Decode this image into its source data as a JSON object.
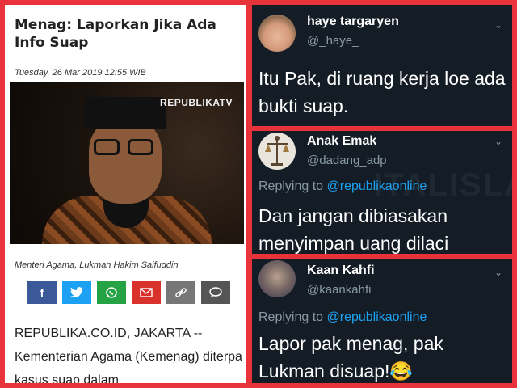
{
  "article": {
    "headline": "Menag: Laporkan Jika Ada Info Suap",
    "date": "Tuesday, 26 Mar 2019 12:55 WIB",
    "photo_brand": "REPUBLIKATV",
    "caption": "Menteri Agama, Lukman Hakim Saifuddin",
    "share_icons": [
      "facebook-icon",
      "twitter-icon",
      "whatsapp-icon",
      "mail-icon",
      "link-icon",
      "comment-icon"
    ],
    "body": "REPUBLIKA.CO.ID, JAKARTA -- Kementerian Agama (Kemenag) diterpa kasus suap dalam"
  },
  "tweets": [
    {
      "name": "haye targaryen",
      "handle": "@_haye_",
      "text": "Itu Pak, di ruang kerja loe ada bukti suap."
    },
    {
      "name": "Anak Emak",
      "handle": "@dadang_adp",
      "replying_label": "Replying to ",
      "mention": "@republikaonline",
      "text": "Dan jangan dibiasakan menyimpan uang dilaci"
    },
    {
      "name": "Kaan Kahfi",
      "handle": "@kaankahfi",
      "replying_label": "Replying to ",
      "mention": "@republikaonline",
      "text": "Lapor pak menag, pak Lukman disuap!😂"
    }
  ],
  "colors": {
    "frame": "#e8333a",
    "tweet_bg": "#141d26",
    "mention": "#1da1f2",
    "muted": "#8899a6"
  }
}
